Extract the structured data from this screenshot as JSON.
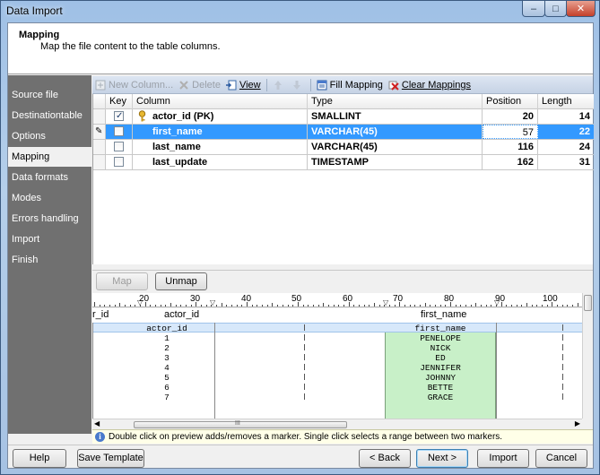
{
  "window": {
    "title": "Data Import",
    "min": "–",
    "max": "□",
    "close": "✕"
  },
  "header": {
    "title": "Mapping",
    "subtitle": "Map the file content to the table columns."
  },
  "sidebar": {
    "items": [
      {
        "label": "Source file",
        "active": false
      },
      {
        "label": "Destinationtable",
        "active": false
      },
      {
        "label": "Options",
        "active": false
      },
      {
        "label": "Mapping",
        "active": true
      },
      {
        "label": "Data formats",
        "active": false
      },
      {
        "label": "Modes",
        "active": false
      },
      {
        "label": "Errors handling",
        "active": false
      },
      {
        "label": "Import",
        "active": false
      },
      {
        "label": "Finish",
        "active": false
      }
    ]
  },
  "toolbar": {
    "new_column": "New Column...",
    "delete": "Delete",
    "view": "View",
    "fill_mapping": "Fill Mapping",
    "clear_mappings": "Clear Mappings"
  },
  "grid": {
    "columns": {
      "key": "Key",
      "column": "Column",
      "type": "Type",
      "position": "Position",
      "length": "Length"
    },
    "rows": [
      {
        "key": true,
        "column": "actor_id (PK)",
        "type": "SMALLINT",
        "position": "20",
        "length": "14",
        "selected": false,
        "pk": true
      },
      {
        "key": false,
        "column": "first_name",
        "type": "VARCHAR(45)",
        "position": "57",
        "length": "22",
        "selected": true,
        "pk": false
      },
      {
        "key": false,
        "column": "last_name",
        "type": "VARCHAR(45)",
        "position": "116",
        "length": "24",
        "selected": false,
        "pk": false
      },
      {
        "key": false,
        "column": "last_update",
        "type": "TIMESTAMP",
        "position": "162",
        "length": "31",
        "selected": false,
        "pk": false
      }
    ]
  },
  "mapbar": {
    "map": "Map",
    "unmap": "Unmap"
  },
  "ruler": {
    "labels": [
      "20",
      "30",
      "40",
      "50",
      "60",
      "70",
      "80",
      "90",
      "100"
    ]
  },
  "preview": {
    "headers": {
      "left": "r_id",
      "col1": "actor_id",
      "col2": "first_name"
    },
    "selected_row": {
      "col1": "actor_id",
      "col2": "first_name"
    },
    "rows": [
      {
        "id": "1",
        "name": "PENELOPE"
      },
      {
        "id": "2",
        "name": "NICK"
      },
      {
        "id": "3",
        "name": "ED"
      },
      {
        "id": "4",
        "name": "JENNIFER"
      },
      {
        "id": "5",
        "name": "JOHNNY"
      },
      {
        "id": "6",
        "name": "BETTE"
      },
      {
        "id": "7",
        "name": "GRACE"
      }
    ],
    "scroll_thumb": "III"
  },
  "hint": {
    "icon": "i",
    "text": "Double click on preview adds/removes a marker. Single click selects a range between two markers."
  },
  "footer": {
    "help": "Help",
    "save_template": "Save Template",
    "back": "< Back",
    "next": "Next >",
    "import": "Import",
    "cancel": "Cancel"
  }
}
